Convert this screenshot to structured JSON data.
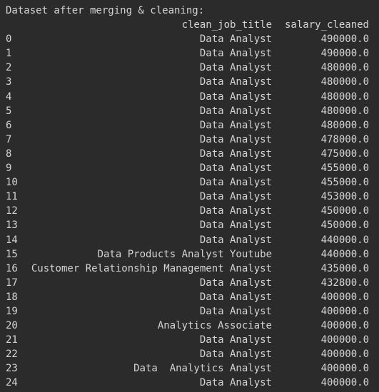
{
  "output": {
    "heading": "Dataset after merging & cleaning:",
    "columns": {
      "clean_job_title": "clean_job_title",
      "salary_cleaned": "salary_cleaned"
    },
    "rows": [
      {
        "index": "0",
        "clean_job_title": "Data Analyst",
        "salary_cleaned": "490000.0"
      },
      {
        "index": "1",
        "clean_job_title": "Data Analyst",
        "salary_cleaned": "490000.0"
      },
      {
        "index": "2",
        "clean_job_title": "Data Analyst",
        "salary_cleaned": "480000.0"
      },
      {
        "index": "3",
        "clean_job_title": "Data Analyst",
        "salary_cleaned": "480000.0"
      },
      {
        "index": "4",
        "clean_job_title": "Data Analyst",
        "salary_cleaned": "480000.0"
      },
      {
        "index": "5",
        "clean_job_title": "Data Analyst",
        "salary_cleaned": "480000.0"
      },
      {
        "index": "6",
        "clean_job_title": "Data Analyst",
        "salary_cleaned": "480000.0"
      },
      {
        "index": "7",
        "clean_job_title": "Data Analyst",
        "salary_cleaned": "478000.0"
      },
      {
        "index": "8",
        "clean_job_title": "Data Analyst",
        "salary_cleaned": "475000.0"
      },
      {
        "index": "9",
        "clean_job_title": "Data Analyst",
        "salary_cleaned": "455000.0"
      },
      {
        "index": "10",
        "clean_job_title": "Data Analyst",
        "salary_cleaned": "455000.0"
      },
      {
        "index": "11",
        "clean_job_title": "Data Analyst",
        "salary_cleaned": "453000.0"
      },
      {
        "index": "12",
        "clean_job_title": "Data Analyst",
        "salary_cleaned": "450000.0"
      },
      {
        "index": "13",
        "clean_job_title": "Data Analyst",
        "salary_cleaned": "450000.0"
      },
      {
        "index": "14",
        "clean_job_title": "Data Analyst",
        "salary_cleaned": "440000.0"
      },
      {
        "index": "15",
        "clean_job_title": "Data Products Analyst Youtube",
        "salary_cleaned": "440000.0"
      },
      {
        "index": "16",
        "clean_job_title": "Customer Relationship Management Analyst",
        "salary_cleaned": "435000.0"
      },
      {
        "index": "17",
        "clean_job_title": "Data Analyst",
        "salary_cleaned": "432800.0"
      },
      {
        "index": "18",
        "clean_job_title": "Data Analyst",
        "salary_cleaned": "400000.0"
      },
      {
        "index": "19",
        "clean_job_title": "Data Analyst",
        "salary_cleaned": "400000.0"
      },
      {
        "index": "20",
        "clean_job_title": "Analytics Associate",
        "salary_cleaned": "400000.0"
      },
      {
        "index": "21",
        "clean_job_title": "Data Analyst",
        "salary_cleaned": "400000.0"
      },
      {
        "index": "22",
        "clean_job_title": "Data Analyst",
        "salary_cleaned": "400000.0"
      },
      {
        "index": "23",
        "clean_job_title": "Data  Analytics Analyst",
        "salary_cleaned": "400000.0"
      },
      {
        "index": "24",
        "clean_job_title": "Data Analyst",
        "salary_cleaned": "400000.0"
      }
    ]
  }
}
